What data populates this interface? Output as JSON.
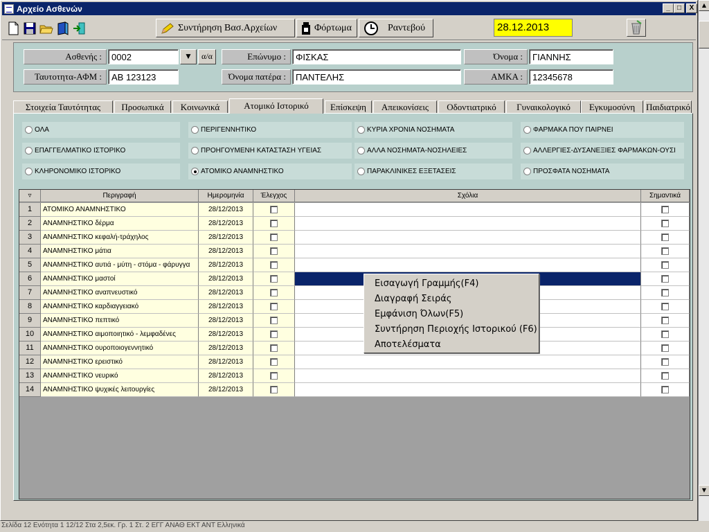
{
  "window": {
    "title": "Αρχείο Ασθενών",
    "min": "_",
    "max": "□",
    "close": "X"
  },
  "toolbar": {
    "maintenance_label": "Συντήρηση Βασ.Αρχείων",
    "load_label": "Φόρτωμα",
    "appointment_label": "Ραντεβού",
    "date": "28.12.2013"
  },
  "form": {
    "patient_label": "Ασθενής :",
    "patient_value": "0002",
    "aa_button": "α/α",
    "id_label": "Ταυτοτητα-ΑΦΜ :",
    "id_value": "ΑΒ 123123",
    "surname_label": "Επώνυμο :",
    "surname_value": "ΦΙΣΚΑΣ",
    "father_label": "Όνομα πατέρα :",
    "father_value": "ΠΑΝΤΕΛΗΣ",
    "name_label": "Όνομα :",
    "name_value": "ΓΙΑΝΝΗΣ",
    "amka_label": "ΑΜΚΑ :",
    "amka_value": "12345678"
  },
  "tabs": [
    "Στοιχεία Ταυτότητας",
    "Προσωπικά",
    "Κοινωνικά",
    "Ατομικό Ιστορικό",
    "Επίσκεψη",
    "Απεικονίσεις",
    "Οδοντιατρικό",
    "Γυναικολογικό",
    "Εγκυμοσύνη",
    "Παιδιατρικό"
  ],
  "active_tab": "Ατομικό Ιστορικό",
  "radios": [
    [
      "ΟΛΑ",
      "ΠΕΡΙΓΕΝΝΗΤΙΚΟ",
      "ΚΥΡΙΑ ΧΡΟΝΙΑ ΝΟΣΗΜΑΤΑ",
      "ΦΑΡΜΑΚΑ ΠΟΥ ΠΑΙΡΝΕΙ"
    ],
    [
      "ΕΠΑΓΓΕΛΜΑΤΙΚΟ ΙΣΤΟΡΙΚΟ",
      "ΠΡΟΗΓΟΥΜΕΝΗ ΚΑΤΑΣΤΑΣΗ ΥΓΕΙΑΣ",
      "ΑΛΛΑ ΝΟΣΗΜΑΤΑ-ΝΟΣΗΛΕΙΕΣ",
      "ΑΛΛΕΡΓΙΕΣ-ΔΥΣΑΝΕΞΙΕΣ ΦΑΡΜΑΚΩΝ-ΟΥΣΙ"
    ],
    [
      "ΚΛΗΡΟΝΟΜΙΚΟ ΙΣΤΟΡΙΚΟ",
      "ΑΤΟΜΙΚΟ ΑΝΑΜΝΗΣΤΙΚΟ",
      "ΠΑΡΑΚΛΙΝΙΚΕΣ ΕΞΕΤΑΣΕΙΣ",
      "ΠΡΟΣΦΑΤΑ ΝΟΣΗΜΑΤΑ"
    ]
  ],
  "selected_radio": "ΑΤΟΜΙΚΟ ΑΝΑΜΝΗΣΤΙΚΟ",
  "grid": {
    "corner": "▿",
    "headers": [
      "Περιγραφή",
      "Ημερομηνία",
      "Έλεγχος",
      "Σχόλια",
      "Σημαντικά"
    ],
    "rows": [
      {
        "n": "1",
        "desc": "ΑΤΟΜΙΚΟ ΑΝΑΜΝΗΣΤΙΚΟ",
        "date": "28/12/2013"
      },
      {
        "n": "2",
        "desc": "ΑΝΑΜΝΗΣΤΙΚΟ δέρμα",
        "date": "28/12/2013"
      },
      {
        "n": "3",
        "desc": "ΑΝΑΜΝΗΣΤΙΚΟ κεφαλή-τράχηλος",
        "date": "28/12/2013"
      },
      {
        "n": "4",
        "desc": "ΑΝΑΜΝΗΣΤΙΚΟ μάτια",
        "date": "28/12/2013"
      },
      {
        "n": "5",
        "desc": "ΑΝΑΜΝΗΣΤΙΚΟ αυτιά - μύτη - στόμα - φάρυγγα",
        "date": "28/12/2013"
      },
      {
        "n": "6",
        "desc": "ΑΝΑΜΝΗΣΤΙΚΟ μαστοί",
        "date": "28/12/2013"
      },
      {
        "n": "7",
        "desc": "ΑΝΑΜΝΗΣΤΙΚΟ αναπνευστικό",
        "date": "28/12/2013"
      },
      {
        "n": "8",
        "desc": "ΑΝΑΜΝΗΣΤΙΚΟ καρδιαγγειακό",
        "date": "28/12/2013"
      },
      {
        "n": "9",
        "desc": "ΑΝΑΜΝΗΣΤΙΚΟ πεπτικό",
        "date": "28/12/2013"
      },
      {
        "n": "10",
        "desc": "ΑΝΑΜΝΗΣΤΙΚΟ αιμοποιητικό - λεμφαδένες",
        "date": "28/12/2013"
      },
      {
        "n": "11",
        "desc": "ΑΝΑΜΝΗΣΤΙΚΟ ουροποιογεννητικό",
        "date": "28/12/2013"
      },
      {
        "n": "12",
        "desc": "ΑΝΑΜΝΗΣΤΙΚΟ ερειστικό",
        "date": "28/12/2013"
      },
      {
        "n": "13",
        "desc": "ΑΝΑΜΝΗΣΤΙΚΟ νευρικό",
        "date": "28/12/2013"
      },
      {
        "n": "14",
        "desc": "ΑΝΑΜΝΗΣΤΙΚΟ ψυχικές λειτουργίες",
        "date": "28/12/2013"
      }
    ],
    "selected_row": 6
  },
  "context_menu": [
    "Εισαγωγή Γραμμής(F4)",
    "Διαγραφή Σειράς",
    "Εμφάνιση Όλων(F5)",
    "Συντήρηση Περιοχής Ιστορικού (F6)",
    "Αποτελέσματα"
  ],
  "status_text": "Σελίδα  12      Ενότητα  1          12/12        Στα  2,5εκ.     Γρ.  1     Στ.  2        ΕΓΓ   ΑΝΑΘ   ΕΚΤ   ΑΝΤ     Ελληνικά",
  "colors": {
    "title_bg": "#0a246a",
    "panel": "#b8d0cc",
    "date_bg": "#ffff00",
    "selection": "#0a246a"
  }
}
